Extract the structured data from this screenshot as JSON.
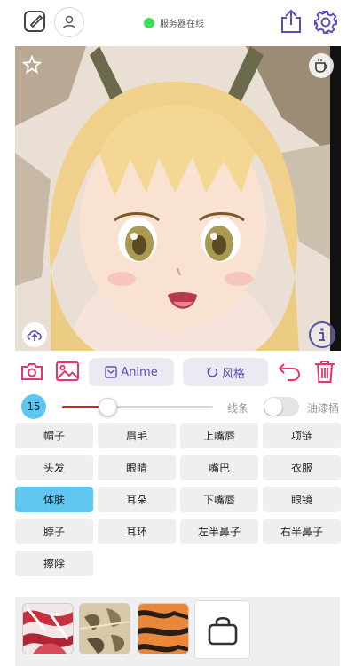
{
  "status": {
    "text": "服务器在线",
    "dot_color": "#3ddc5a"
  },
  "topbar": {
    "left_icons": [
      "edit-note-icon",
      "user-icon"
    ],
    "right_icons": [
      "share-icon",
      "gear-icon"
    ]
  },
  "colors": {
    "accent": "#5b4fb8",
    "pink": "#e8336e",
    "selected": "#5ec6ef",
    "slider": "#e02020"
  },
  "toolbar": {
    "anime_label": "Anime",
    "style_label": "风格"
  },
  "brush": {
    "size": "15",
    "slider_fraction": 0.3,
    "line_label": "线条",
    "oil_label": "油漆桶",
    "toggle_on": false
  },
  "parts": [
    "帽子",
    "眉毛",
    "上嘴唇",
    "项链",
    "头发",
    "眼睛",
    "嘴巴",
    "衣服",
    "体肤",
    "耳朵",
    "下嘴唇",
    "眼镜",
    "脖子",
    "耳环",
    "左半鼻子",
    "右半鼻子",
    "擦除"
  ],
  "selected_part": "体肤",
  "textures": [
    "red-white-abstract",
    "beige-leaf-pattern",
    "orange-tiger-stripe"
  ]
}
